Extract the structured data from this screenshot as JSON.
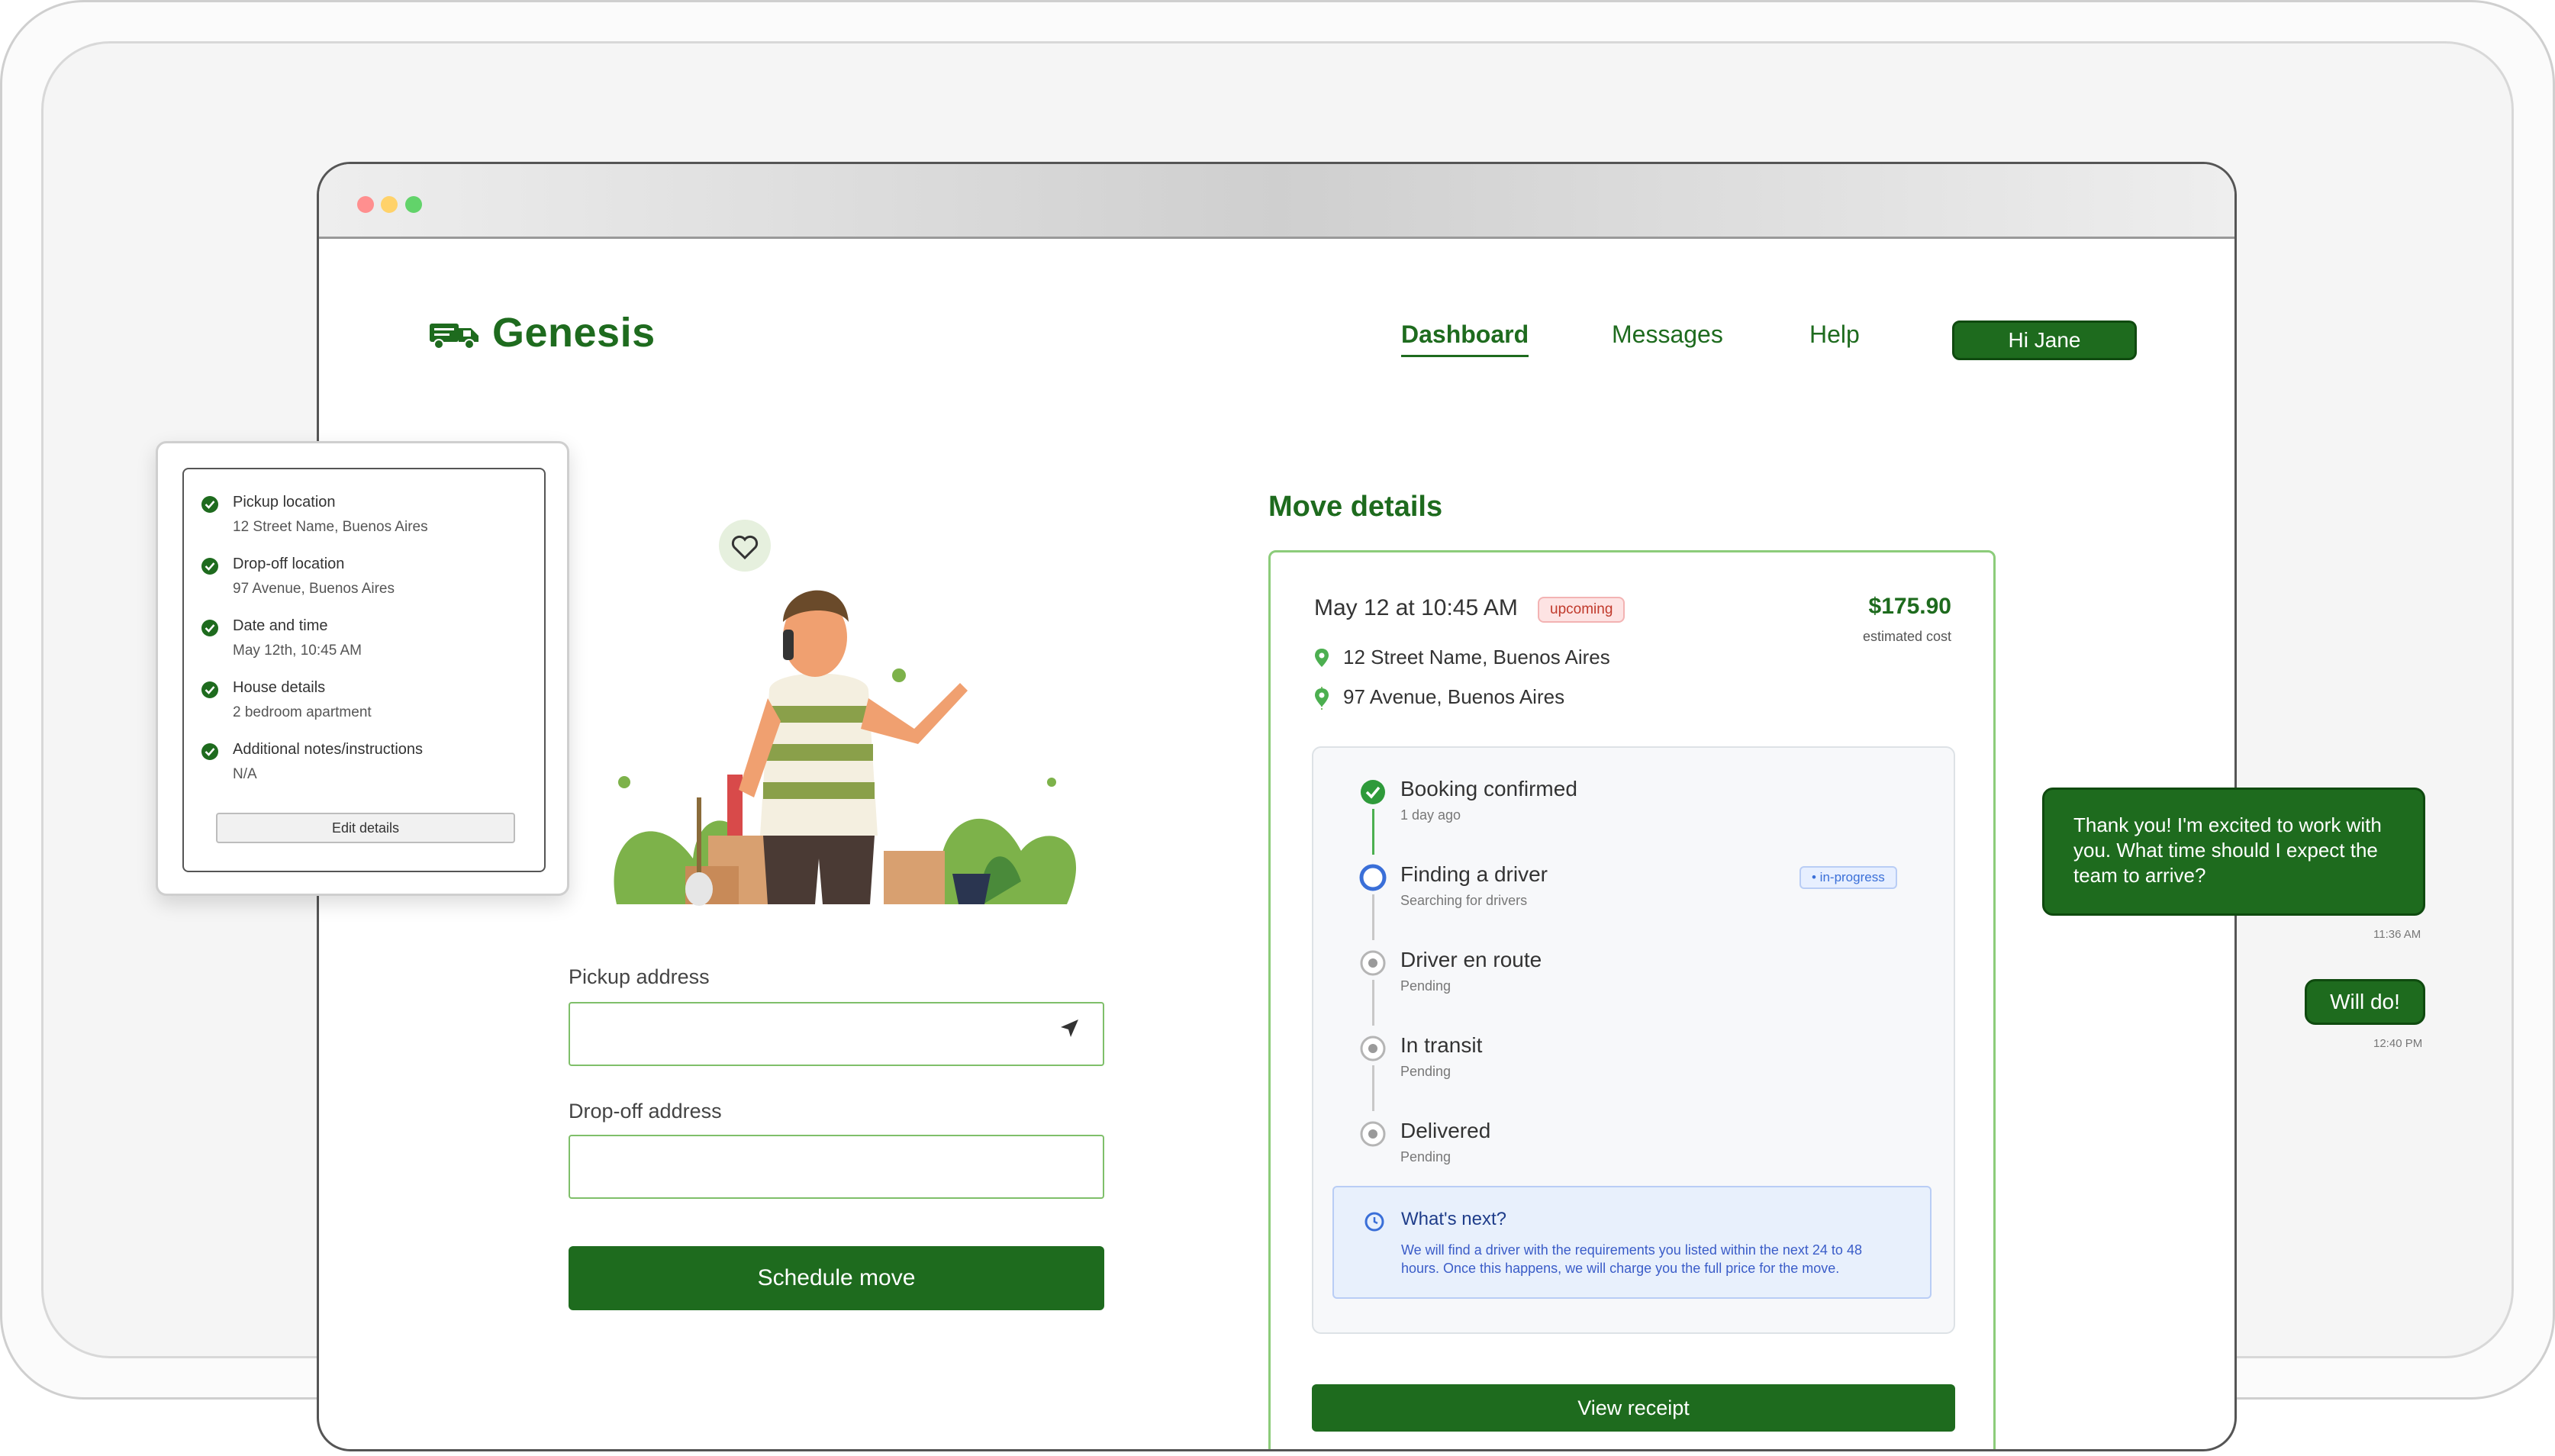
{
  "app": {
    "brand": "Genesis"
  },
  "nav": {
    "dashboard": "Dashboard",
    "messages": "Messages",
    "help": "Help",
    "user_button": "Hi Jane"
  },
  "form": {
    "pickup_label": "Pickup address",
    "pickup_value": "",
    "dropoff_label": "Drop-off address",
    "dropoff_value": "",
    "schedule_button": "Schedule move"
  },
  "move": {
    "title": "Move details",
    "date": "May 12 at 10:45 AM",
    "status_badge": "upcoming",
    "price": "$175.90",
    "price_label": "estimated cost",
    "pickup": "12 Street Name, Buenos Aires",
    "dropoff": "97 Avenue, Buenos Aires",
    "steps": [
      {
        "title": "Booking confirmed",
        "sub": "1 day ago",
        "state": "done"
      },
      {
        "title": "Finding a driver",
        "sub": "Searching for drivers",
        "state": "active",
        "badge": "• in-progress"
      },
      {
        "title": "Driver en route",
        "sub": "Pending",
        "state": "pending"
      },
      {
        "title": "In transit",
        "sub": "Pending",
        "state": "pending"
      },
      {
        "title": "Delivered",
        "sub": "Pending",
        "state": "pending"
      }
    ],
    "next": {
      "title": "What's next?",
      "text": "We will find a driver with the requirements you listed within the next 24 to 48 hours. Once this happens, we will charge you the full price for the move."
    },
    "receipt_button": "View receipt"
  },
  "summary": {
    "items": [
      {
        "label": "Pickup location",
        "value": "12 Street Name, Buenos Aires"
      },
      {
        "label": "Drop-off location",
        "value": "97 Avenue, Buenos Aires"
      },
      {
        "label": "Date and time",
        "value": "May 12th, 10:45 AM"
      },
      {
        "label": "House details",
        "value": "2 bedroom apartment"
      },
      {
        "label": "Additional notes/instructions",
        "value": "N/A"
      }
    ],
    "edit_button": "Edit details"
  },
  "chat": {
    "messages": [
      {
        "text": "Thank you! I'm excited to work with you. What time should I expect the team to arrive?",
        "time": "11:36 AM"
      },
      {
        "text": "Will do!",
        "time": "12:40 PM"
      }
    ]
  },
  "colors": {
    "brand": "#1e6b1e",
    "accent_light": "#8ccc7a",
    "info_blue": "#3a6fd8",
    "alert_red": "#c0392b"
  },
  "icons": [
    "truck-icon",
    "send-arrow-icon",
    "map-pin-icon",
    "check-circle-icon",
    "progress-dot-icon",
    "pending-dot-icon",
    "clock-icon",
    "heart-icon"
  ]
}
